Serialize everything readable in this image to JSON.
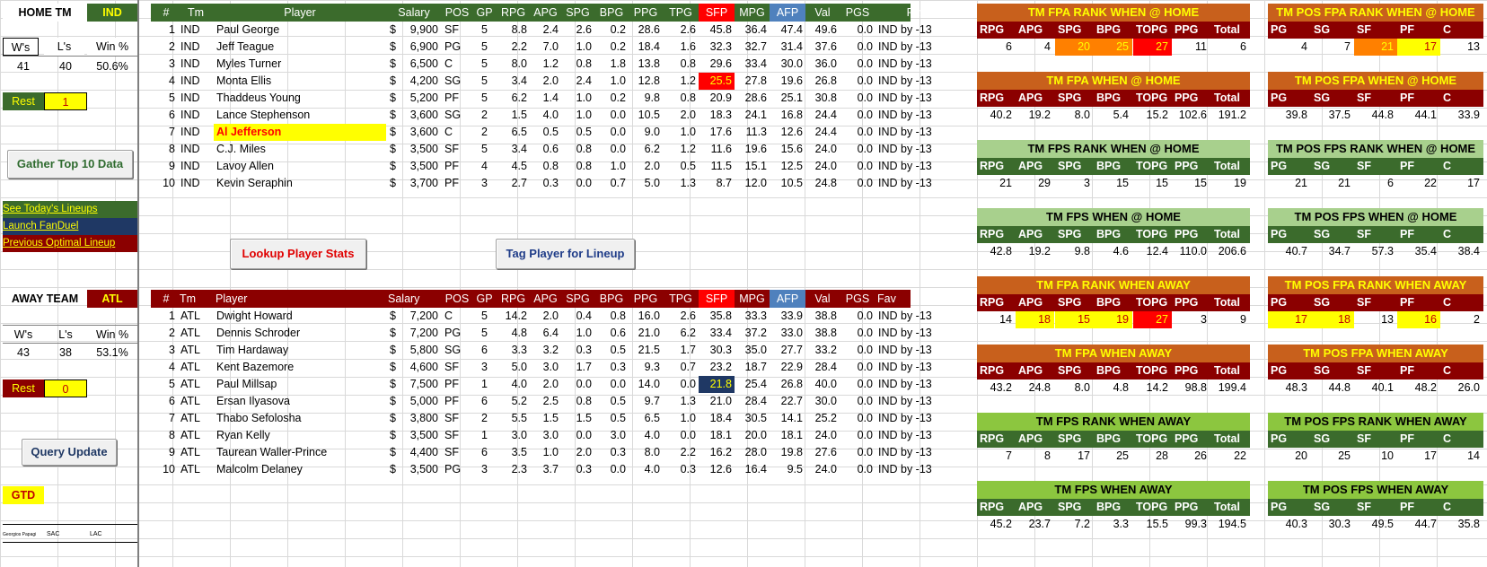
{
  "home_team": {
    "label": "HOME TM",
    "code": "IND",
    "wins_label": "W's",
    "losses_label": "L's",
    "winpct_label": "Win %",
    "wins": "41",
    "losses": "40",
    "winpct": "50.6%",
    "rest_label": "Rest",
    "rest": "1"
  },
  "away_team": {
    "label": "AWAY TEAM",
    "code": "ATL",
    "wins_label": "W's",
    "losses_label": "L's",
    "winpct_label": "Win %",
    "wins": "43",
    "losses": "38",
    "winpct": "53.1%",
    "rest_label": "Rest",
    "rest": "0"
  },
  "buttons": {
    "gather": "Gather Top 10 Data",
    "lookup": "Lookup Player Stats",
    "tag": "Tag Player for Lineup",
    "query": "Query Update"
  },
  "links": {
    "lineups": "See Today's Lineups",
    "fanduel": "Launch FanDuel",
    "optimal": "Previous Optimal Lineup"
  },
  "gtd_label": "GTD",
  "tiny_cells": [
    "Georgios Papagi",
    "SAC",
    "LAC"
  ],
  "player_headers": [
    "#",
    "Tm",
    "Player",
    "Salary",
    "POS",
    "GP",
    "RPG",
    "APG",
    "SPG",
    "BPG",
    "PPG",
    "TPG",
    "SFP",
    "MPG",
    "AFP",
    "Val",
    "PGS",
    "Fav"
  ],
  "home_players": [
    [
      "1",
      "IND",
      "Paul George",
      "$",
      "9,900",
      "SF",
      "5",
      "8.8",
      "2.4",
      "2.6",
      "0.2",
      "28.6",
      "2.6",
      "45.8",
      "36.4",
      "47.4",
      "49.6",
      "0.0",
      "IND by -13"
    ],
    [
      "2",
      "IND",
      "Jeff Teague",
      "$",
      "6,900",
      "PG",
      "5",
      "2.2",
      "7.0",
      "1.0",
      "0.2",
      "18.4",
      "1.6",
      "32.3",
      "32.7",
      "31.4",
      "37.6",
      "0.0",
      "IND by -13"
    ],
    [
      "3",
      "IND",
      "Myles Turner",
      "$",
      "6,500",
      "C",
      "5",
      "8.0",
      "1.2",
      "0.8",
      "1.8",
      "13.8",
      "0.8",
      "29.6",
      "33.4",
      "30.0",
      "36.0",
      "0.0",
      "IND by -13"
    ],
    [
      "4",
      "IND",
      "Monta Ellis",
      "$",
      "4,200",
      "SG",
      "5",
      "3.4",
      "2.0",
      "2.4",
      "1.0",
      "12.8",
      "1.2",
      "25.5",
      "27.8",
      "19.6",
      "26.8",
      "0.0",
      "IND by -13"
    ],
    [
      "5",
      "IND",
      "Thaddeus Young",
      "$",
      "5,200",
      "PF",
      "5",
      "6.2",
      "1.4",
      "1.0",
      "0.2",
      "9.8",
      "0.8",
      "20.9",
      "28.6",
      "25.1",
      "30.8",
      "0.0",
      "IND by -13"
    ],
    [
      "6",
      "IND",
      "Lance Stephenson",
      "$",
      "3,600",
      "SG",
      "2",
      "1.5",
      "4.0",
      "1.0",
      "0.0",
      "10.5",
      "2.0",
      "18.3",
      "24.1",
      "16.8",
      "24.4",
      "0.0",
      "IND by -13"
    ],
    [
      "7",
      "IND",
      "Al Jefferson",
      "$",
      "3,600",
      "C",
      "2",
      "6.5",
      "0.5",
      "0.5",
      "0.0",
      "9.0",
      "1.0",
      "17.6",
      "11.3",
      "12.6",
      "24.4",
      "0.0",
      "IND by -13"
    ],
    [
      "8",
      "IND",
      "C.J. Miles",
      "$",
      "3,500",
      "SF",
      "5",
      "3.4",
      "0.6",
      "0.8",
      "0.0",
      "6.2",
      "1.2",
      "11.6",
      "19.6",
      "15.6",
      "24.0",
      "0.0",
      "IND by -13"
    ],
    [
      "9",
      "IND",
      "Lavoy Allen",
      "$",
      "3,500",
      "PF",
      "4",
      "4.5",
      "0.8",
      "0.8",
      "1.0",
      "2.0",
      "0.5",
      "11.5",
      "15.1",
      "12.5",
      "24.0",
      "0.0",
      "IND by -13"
    ],
    [
      "10",
      "IND",
      "Kevin Seraphin",
      "$",
      "3,700",
      "PF",
      "3",
      "2.7",
      "0.3",
      "0.0",
      "0.7",
      "5.0",
      "1.3",
      "8.7",
      "12.0",
      "10.5",
      "24.8",
      "0.0",
      "IND by -13"
    ]
  ],
  "away_players": [
    [
      "1",
      "ATL",
      "Dwight Howard",
      "$",
      "7,200",
      "C",
      "5",
      "14.2",
      "2.0",
      "0.4",
      "0.8",
      "16.0",
      "2.6",
      "35.8",
      "33.3",
      "33.9",
      "38.8",
      "0.0",
      "IND by -13"
    ],
    [
      "2",
      "ATL",
      "Dennis Schroder",
      "$",
      "7,200",
      "PG",
      "5",
      "4.8",
      "6.4",
      "1.0",
      "0.6",
      "21.0",
      "6.2",
      "33.4",
      "37.2",
      "33.0",
      "38.8",
      "0.0",
      "IND by -13"
    ],
    [
      "3",
      "ATL",
      "Tim Hardaway",
      "$",
      "5,800",
      "SG",
      "6",
      "3.3",
      "3.2",
      "0.3",
      "0.5",
      "21.5",
      "1.7",
      "30.3",
      "35.0",
      "27.7",
      "33.2",
      "0.0",
      "IND by -13"
    ],
    [
      "4",
      "ATL",
      "Kent Bazemore",
      "$",
      "4,600",
      "SF",
      "3",
      "5.0",
      "3.0",
      "1.7",
      "0.3",
      "9.3",
      "0.7",
      "23.2",
      "18.7",
      "22.9",
      "28.4",
      "0.0",
      "IND by -13"
    ],
    [
      "5",
      "ATL",
      "Paul Millsap",
      "$",
      "7,500",
      "PF",
      "1",
      "4.0",
      "2.0",
      "0.0",
      "0.0",
      "14.0",
      "0.0",
      "21.8",
      "25.4",
      "26.8",
      "40.0",
      "0.0",
      "IND by -13"
    ],
    [
      "6",
      "ATL",
      "Ersan Ilyasova",
      "$",
      "5,000",
      "PF",
      "6",
      "5.2",
      "2.5",
      "0.8",
      "0.5",
      "9.7",
      "1.3",
      "21.0",
      "28.4",
      "22.7",
      "30.0",
      "0.0",
      "IND by -13"
    ],
    [
      "7",
      "ATL",
      "Thabo Sefolosha",
      "$",
      "3,800",
      "SF",
      "2",
      "5.5",
      "1.5",
      "1.5",
      "0.5",
      "6.5",
      "1.0",
      "18.4",
      "30.5",
      "14.1",
      "25.2",
      "0.0",
      "IND by -13"
    ],
    [
      "8",
      "ATL",
      "Ryan Kelly",
      "$",
      "3,500",
      "SF",
      "1",
      "3.0",
      "3.0",
      "0.0",
      "3.0",
      "4.0",
      "0.0",
      "18.1",
      "20.0",
      "18.1",
      "24.0",
      "0.0",
      "IND by -13"
    ],
    [
      "9",
      "ATL",
      "Taurean Waller-Prince",
      "$",
      "4,400",
      "SF",
      "6",
      "3.5",
      "1.0",
      "2.0",
      "0.3",
      "8.0",
      "2.2",
      "16.2",
      "28.0",
      "19.8",
      "27.6",
      "0.0",
      "IND by -13"
    ],
    [
      "10",
      "ATL",
      "Malcolm Delaney",
      "$",
      "3,500",
      "PG",
      "3",
      "2.3",
      "3.7",
      "0.3",
      "0.0",
      "4.0",
      "0.3",
      "12.6",
      "16.4",
      "9.5",
      "24.0",
      "0.0",
      "IND by -13"
    ]
  ],
  "team_stat_headers": [
    "RPG",
    "APG",
    "SPG",
    "BPG",
    "TOPG",
    "PPG",
    "Total"
  ],
  "pos_stat_headers": [
    "PG",
    "SG",
    "SF",
    "PF",
    "C"
  ],
  "team_panels": [
    {
      "title": "TM FPA RANK WHEN @ HOME",
      "values": [
        "6",
        "4",
        "20",
        "25",
        "27",
        "11",
        "6"
      ],
      "style": "r"
    },
    {
      "title": "TM FPA WHEN @ HOME",
      "values": [
        "40.2",
        "19.2",
        "8.0",
        "5.4",
        "15.2",
        "102.6",
        "191.2"
      ],
      "style": "o"
    },
    {
      "title": "TM FPS RANK WHEN @ HOME",
      "values": [
        "21",
        "29",
        "3",
        "15",
        "15",
        "15",
        "19"
      ],
      "style": "lg"
    },
    {
      "title": "TM FPS WHEN @ HOME",
      "values": [
        "42.8",
        "19.2",
        "9.8",
        "4.6",
        "12.4",
        "110.0",
        "206.6"
      ],
      "style": "lg"
    },
    {
      "title": "TM FPA RANK WHEN AWAY",
      "values": [
        "14",
        "18",
        "15",
        "19",
        "27",
        "3",
        "9"
      ],
      "style": "o"
    },
    {
      "title": "TM FPA WHEN AWAY",
      "values": [
        "43.2",
        "24.8",
        "8.0",
        "4.8",
        "14.2",
        "98.8",
        "199.4"
      ],
      "style": "o"
    },
    {
      "title": "TM FPS RANK WHEN AWAY",
      "values": [
        "7",
        "8",
        "17",
        "25",
        "28",
        "26",
        "22"
      ],
      "style": "yg"
    },
    {
      "title": "TM FPS WHEN AWAY",
      "values": [
        "45.2",
        "23.7",
        "7.2",
        "3.3",
        "15.5",
        "99.3",
        "194.5"
      ],
      "style": "yg"
    }
  ],
  "pos_panels": [
    {
      "title": "TM POS FPA RANK WHEN @ HOME",
      "values": [
        "4",
        "7",
        "21",
        "17",
        "13"
      ],
      "style": "o"
    },
    {
      "title": "TM POS FPA WHEN @ HOME",
      "values": [
        "39.8",
        "37.5",
        "44.8",
        "44.1",
        "33.9"
      ],
      "style": "o"
    },
    {
      "title": "TM POS FPS RANK WHEN @ HOME",
      "values": [
        "21",
        "21",
        "6",
        "22",
        "17"
      ],
      "style": "lg"
    },
    {
      "title": "TM POS FPS WHEN @ HOME",
      "values": [
        "40.7",
        "34.7",
        "57.3",
        "35.4",
        "38.4"
      ],
      "style": "lg"
    },
    {
      "title": "TM POS FPA RANK WHEN AWAY",
      "values": [
        "17",
        "18",
        "13",
        "16",
        "2"
      ],
      "style": "o"
    },
    {
      "title": "TM POS FPA WHEN AWAY",
      "values": [
        "48.3",
        "44.8",
        "40.1",
        "48.2",
        "26.0"
      ],
      "style": "o"
    },
    {
      "title": "TM POS FPS RANK WHEN AWAY",
      "values": [
        "20",
        "25",
        "10",
        "17",
        "14"
      ],
      "style": "yg"
    },
    {
      "title": "TM POS FPS WHEN AWAY",
      "values": [
        "40.3",
        "30.3",
        "49.5",
        "44.7",
        "35.8"
      ],
      "style": "yg"
    }
  ],
  "colors": {
    "header_green": "#3b6b2c",
    "header_red": "#8b0000",
    "highlight_yellow": "#ffff00",
    "highlight_orange": "#ff8000",
    "sfp_red": "#ff0000",
    "afp_blue": "#4f81bd",
    "sfp_navy": "#1f3864"
  }
}
